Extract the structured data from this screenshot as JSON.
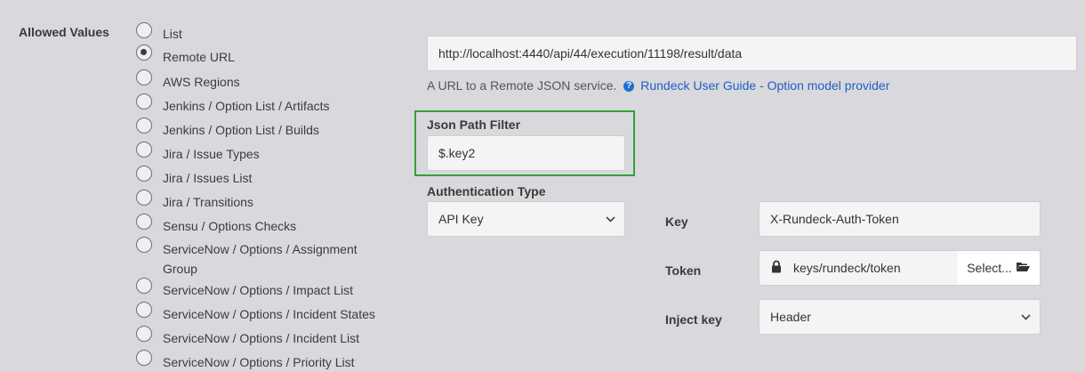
{
  "allowed_values_label": "Allowed Values",
  "radio_options": [
    {
      "label": "List",
      "checked": false
    },
    {
      "label": "Remote URL",
      "checked": true
    },
    {
      "label": "AWS Regions",
      "checked": false
    },
    {
      "label": "Jenkins / Option List / Artifacts",
      "checked": false
    },
    {
      "label": "Jenkins / Option List / Builds",
      "checked": false
    },
    {
      "label": "Jira / Issue Types",
      "checked": false
    },
    {
      "label": "Jira / Issues List",
      "checked": false
    },
    {
      "label": "Jira / Transitions",
      "checked": false
    },
    {
      "label": "Sensu / Options Checks",
      "checked": false
    },
    {
      "label": "ServiceNow / Options / Assignment",
      "label2": "Group",
      "checked": false
    },
    {
      "label": "ServiceNow / Options / Impact List",
      "checked": false
    },
    {
      "label": "ServiceNow / Options / Incident States",
      "checked": false
    },
    {
      "label": "ServiceNow / Options / Incident List",
      "checked": false
    },
    {
      "label": "ServiceNow / Options / Priority List",
      "checked": false
    }
  ],
  "remote_url": {
    "value": "http://localhost:4440/api/44/execution/11198/result/data",
    "help_text": "A URL to a Remote JSON service.",
    "help_link": "Rundeck User Guide - Option model provider"
  },
  "json_path_filter": {
    "label": "Json Path Filter",
    "value": "$.key2"
  },
  "authentication_type": {
    "label": "Authentication Type",
    "value": "API Key"
  },
  "key": {
    "label": "Key",
    "value": "X-Rundeck-Auth-Token"
  },
  "token": {
    "label": "Token",
    "value": "keys/rundeck/token",
    "select_label": "Select..."
  },
  "inject_key": {
    "label": "Inject key",
    "value": "Header"
  },
  "colors": {
    "highlight": "#2ea33b",
    "link": "#1f60c4",
    "background": "#d9d8dc"
  }
}
